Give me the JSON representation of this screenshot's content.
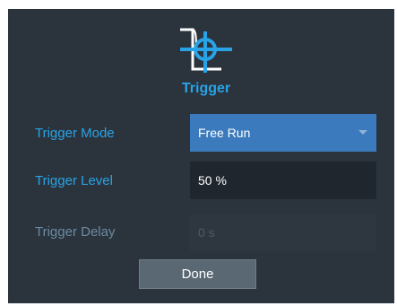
{
  "dialog": {
    "title": "Trigger",
    "icon": "trigger-icon"
  },
  "fields": {
    "mode": {
      "label": "Trigger Mode",
      "value": "Free Run"
    },
    "level": {
      "label": "Trigger Level",
      "value": "50 %"
    },
    "delay": {
      "label": "Trigger Delay",
      "value": "0 s"
    }
  },
  "buttons": {
    "done": "Done"
  },
  "colors": {
    "accent": "#29a3e6",
    "select_bg": "#3b7bbd",
    "dialog_bg": "#2b343d",
    "button_bg": "#5a6874"
  }
}
